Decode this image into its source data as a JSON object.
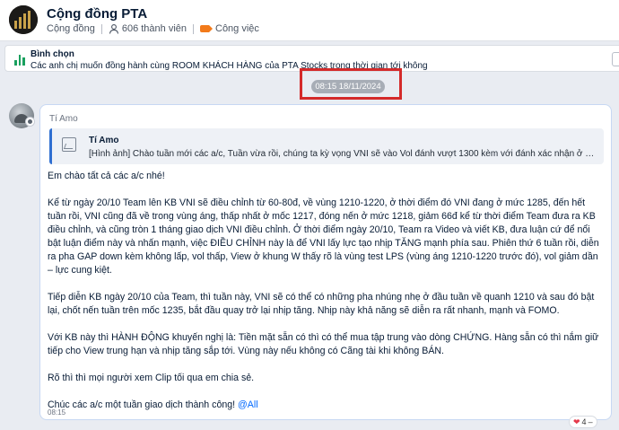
{
  "header": {
    "title": "Cộng đồng PTA",
    "type_label": "Cộng đồng",
    "member_count": "606 thành viên",
    "tag_label": "Công việc"
  },
  "poll": {
    "title": "Bình chọn",
    "question": "Các anh chị muốn đồng hành cùng ROOM KHÁCH HÀNG  của PTA Stocks trong thời gian tới không"
  },
  "divider": {
    "timestamp": "08:15 18/11/2024"
  },
  "message": {
    "sender": "Tí Amo",
    "quote": {
      "author": "Tí Amo",
      "text": "[Hình ảnh] Chào tuần mới các a/c, Tuần vừa rồi, chúng ta kỳ vọng VNI sẽ vào Vol đánh vượt 1300 kèm với đánh xác nhận ở dòng Chứn..."
    },
    "paragraphs": [
      "Em chào tất cả các a/c nhé!",
      "Kể từ ngày 20/10 Team lên KB VNI sẽ điều chỉnh từ 60-80đ, về vùng 1210-1220, ở thời điểm đó VNI đang ở mức 1285, đến hết tuần rồi, VNI cũng đã về trong vùng áng, thấp nhất ở mốc 1217, đóng nến ở mức 1218, giảm 66đ kể từ thời điểm Team đưa ra KB điều chỉnh, và cũng tròn 1 tháng giao dịch VNI điều chỉnh. Ở thời điểm ngày 20/10, Team ra Video và viết KB, đưa luận cứ để nổi bật luận điểm này và nhấn mạnh, việc ĐIỀU CHỈNH này là để VNI lấy lực tạo nhịp TĂNG mạnh phía sau. Phiên thứ 6 tuần rồi, diễn ra pha GAP down kèm không lấp, vol thấp, View ở khung W thấy rõ là vùng test LPS (vùng áng 1210-1220 trước đó), vol giảm dần – lực cung kiệt.",
      "Tiếp diễn KB ngày 20/10 của Team, thì tuần này, VNI sẽ có thể có những pha nhúng nhẹ ở đầu tuần về quanh 1210 và sau đó bật lại, chốt nến tuần trên mốc 1235, bắt đầu quay trở lại nhịp tăng. Nhịp này khả năng sẽ diễn ra rất nhanh, mạnh và FOMO.",
      "Với KB này thì HÀNH ĐỘNG khuyến nghị là: Tiền mặt sẵn có thì có thể mua tập trung vào dòng CHỨNG. Hàng sẵn có thì nắm giữ tiếp cho View trung hạn và nhịp tăng sắp tới. Vùng này nếu không có Cãng tài khi không BÁN.",
      "Rõ thì thì mọi người xem Clip tối qua em chia sẻ."
    ],
    "closing": "Chúc các a/c một tuần giao dịch thành công!",
    "mention": "@All",
    "time": "08:15",
    "reaction_count": "4",
    "reaction_caret": "–"
  },
  "icons": {
    "group_avatar": "pta-logo",
    "members": "person-icon",
    "tag": "tag-icon",
    "poll": "bar-chart-icon",
    "quote_image": "image-icon",
    "reaction": "heart-icon"
  },
  "colors": {
    "accent": "#0068ff",
    "tag": "#f27a1a",
    "poll": "#19a05e",
    "highlight": "#d42a2a",
    "reaction": "#e5394b"
  }
}
